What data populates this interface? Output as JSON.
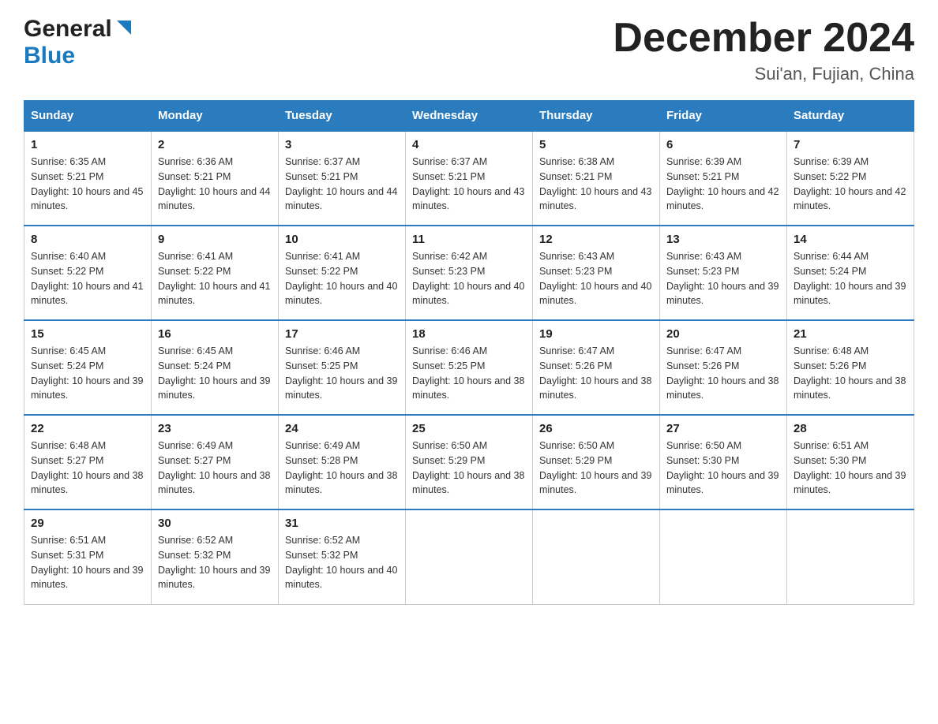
{
  "header": {
    "logo_general": "General",
    "logo_blue": "Blue",
    "title": "December 2024",
    "subtitle": "Sui'an, Fujian, China"
  },
  "calendar": {
    "days_of_week": [
      "Sunday",
      "Monday",
      "Tuesday",
      "Wednesday",
      "Thursday",
      "Friday",
      "Saturday"
    ],
    "weeks": [
      [
        {
          "day": "1",
          "sunrise": "6:35 AM",
          "sunset": "5:21 PM",
          "daylight": "10 hours and 45 minutes."
        },
        {
          "day": "2",
          "sunrise": "6:36 AM",
          "sunset": "5:21 PM",
          "daylight": "10 hours and 44 minutes."
        },
        {
          "day": "3",
          "sunrise": "6:37 AM",
          "sunset": "5:21 PM",
          "daylight": "10 hours and 44 minutes."
        },
        {
          "day": "4",
          "sunrise": "6:37 AM",
          "sunset": "5:21 PM",
          "daylight": "10 hours and 43 minutes."
        },
        {
          "day": "5",
          "sunrise": "6:38 AM",
          "sunset": "5:21 PM",
          "daylight": "10 hours and 43 minutes."
        },
        {
          "day": "6",
          "sunrise": "6:39 AM",
          "sunset": "5:21 PM",
          "daylight": "10 hours and 42 minutes."
        },
        {
          "day": "7",
          "sunrise": "6:39 AM",
          "sunset": "5:22 PM",
          "daylight": "10 hours and 42 minutes."
        }
      ],
      [
        {
          "day": "8",
          "sunrise": "6:40 AM",
          "sunset": "5:22 PM",
          "daylight": "10 hours and 41 minutes."
        },
        {
          "day": "9",
          "sunrise": "6:41 AM",
          "sunset": "5:22 PM",
          "daylight": "10 hours and 41 minutes."
        },
        {
          "day": "10",
          "sunrise": "6:41 AM",
          "sunset": "5:22 PM",
          "daylight": "10 hours and 40 minutes."
        },
        {
          "day": "11",
          "sunrise": "6:42 AM",
          "sunset": "5:23 PM",
          "daylight": "10 hours and 40 minutes."
        },
        {
          "day": "12",
          "sunrise": "6:43 AM",
          "sunset": "5:23 PM",
          "daylight": "10 hours and 40 minutes."
        },
        {
          "day": "13",
          "sunrise": "6:43 AM",
          "sunset": "5:23 PM",
          "daylight": "10 hours and 39 minutes."
        },
        {
          "day": "14",
          "sunrise": "6:44 AM",
          "sunset": "5:24 PM",
          "daylight": "10 hours and 39 minutes."
        }
      ],
      [
        {
          "day": "15",
          "sunrise": "6:45 AM",
          "sunset": "5:24 PM",
          "daylight": "10 hours and 39 minutes."
        },
        {
          "day": "16",
          "sunrise": "6:45 AM",
          "sunset": "5:24 PM",
          "daylight": "10 hours and 39 minutes."
        },
        {
          "day": "17",
          "sunrise": "6:46 AM",
          "sunset": "5:25 PM",
          "daylight": "10 hours and 39 minutes."
        },
        {
          "day": "18",
          "sunrise": "6:46 AM",
          "sunset": "5:25 PM",
          "daylight": "10 hours and 38 minutes."
        },
        {
          "day": "19",
          "sunrise": "6:47 AM",
          "sunset": "5:26 PM",
          "daylight": "10 hours and 38 minutes."
        },
        {
          "day": "20",
          "sunrise": "6:47 AM",
          "sunset": "5:26 PM",
          "daylight": "10 hours and 38 minutes."
        },
        {
          "day": "21",
          "sunrise": "6:48 AM",
          "sunset": "5:26 PM",
          "daylight": "10 hours and 38 minutes."
        }
      ],
      [
        {
          "day": "22",
          "sunrise": "6:48 AM",
          "sunset": "5:27 PM",
          "daylight": "10 hours and 38 minutes."
        },
        {
          "day": "23",
          "sunrise": "6:49 AM",
          "sunset": "5:27 PM",
          "daylight": "10 hours and 38 minutes."
        },
        {
          "day": "24",
          "sunrise": "6:49 AM",
          "sunset": "5:28 PM",
          "daylight": "10 hours and 38 minutes."
        },
        {
          "day": "25",
          "sunrise": "6:50 AM",
          "sunset": "5:29 PM",
          "daylight": "10 hours and 38 minutes."
        },
        {
          "day": "26",
          "sunrise": "6:50 AM",
          "sunset": "5:29 PM",
          "daylight": "10 hours and 39 minutes."
        },
        {
          "day": "27",
          "sunrise": "6:50 AM",
          "sunset": "5:30 PM",
          "daylight": "10 hours and 39 minutes."
        },
        {
          "day": "28",
          "sunrise": "6:51 AM",
          "sunset": "5:30 PM",
          "daylight": "10 hours and 39 minutes."
        }
      ],
      [
        {
          "day": "29",
          "sunrise": "6:51 AM",
          "sunset": "5:31 PM",
          "daylight": "10 hours and 39 minutes."
        },
        {
          "day": "30",
          "sunrise": "6:52 AM",
          "sunset": "5:32 PM",
          "daylight": "10 hours and 39 minutes."
        },
        {
          "day": "31",
          "sunrise": "6:52 AM",
          "sunset": "5:32 PM",
          "daylight": "10 hours and 40 minutes."
        },
        null,
        null,
        null,
        null
      ]
    ]
  }
}
